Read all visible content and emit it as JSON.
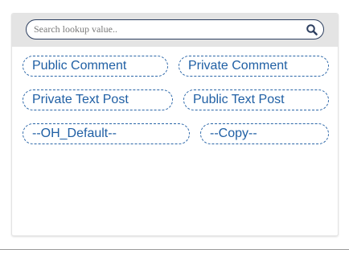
{
  "search": {
    "placeholder": "Search lookup value.."
  },
  "chips": [
    {
      "label": "Public Comment"
    },
    {
      "label": "Private Comment"
    },
    {
      "label": "Private Text Post"
    },
    {
      "label": "Public Text Post"
    },
    {
      "label": "--OH_Default--"
    },
    {
      "label": "--Copy--"
    }
  ],
  "icons": {
    "search": "search-icon"
  },
  "colors": {
    "chip_border": "#2b66a8",
    "chip_text": "#1f5fa4",
    "search_bar_bg": "#e4e4e4",
    "search_border": "#2c3e5f"
  }
}
